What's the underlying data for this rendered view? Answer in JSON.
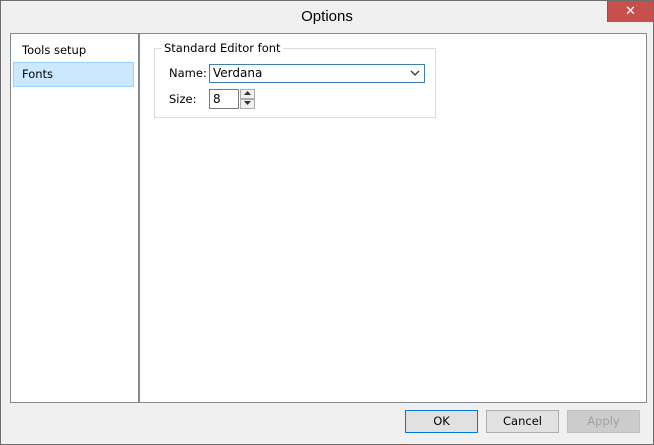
{
  "window": {
    "title": "Options",
    "close_symbol": "✕"
  },
  "nav": {
    "items": [
      {
        "label": "Tools setup"
      },
      {
        "label": "Fonts"
      }
    ]
  },
  "group": {
    "legend": "Standard Editor font",
    "name_label": "Name:",
    "name_value": "Verdana",
    "size_label": "Size:",
    "size_value": "8"
  },
  "buttons": {
    "ok": "OK",
    "cancel": "Cancel",
    "apply": "Apply"
  }
}
